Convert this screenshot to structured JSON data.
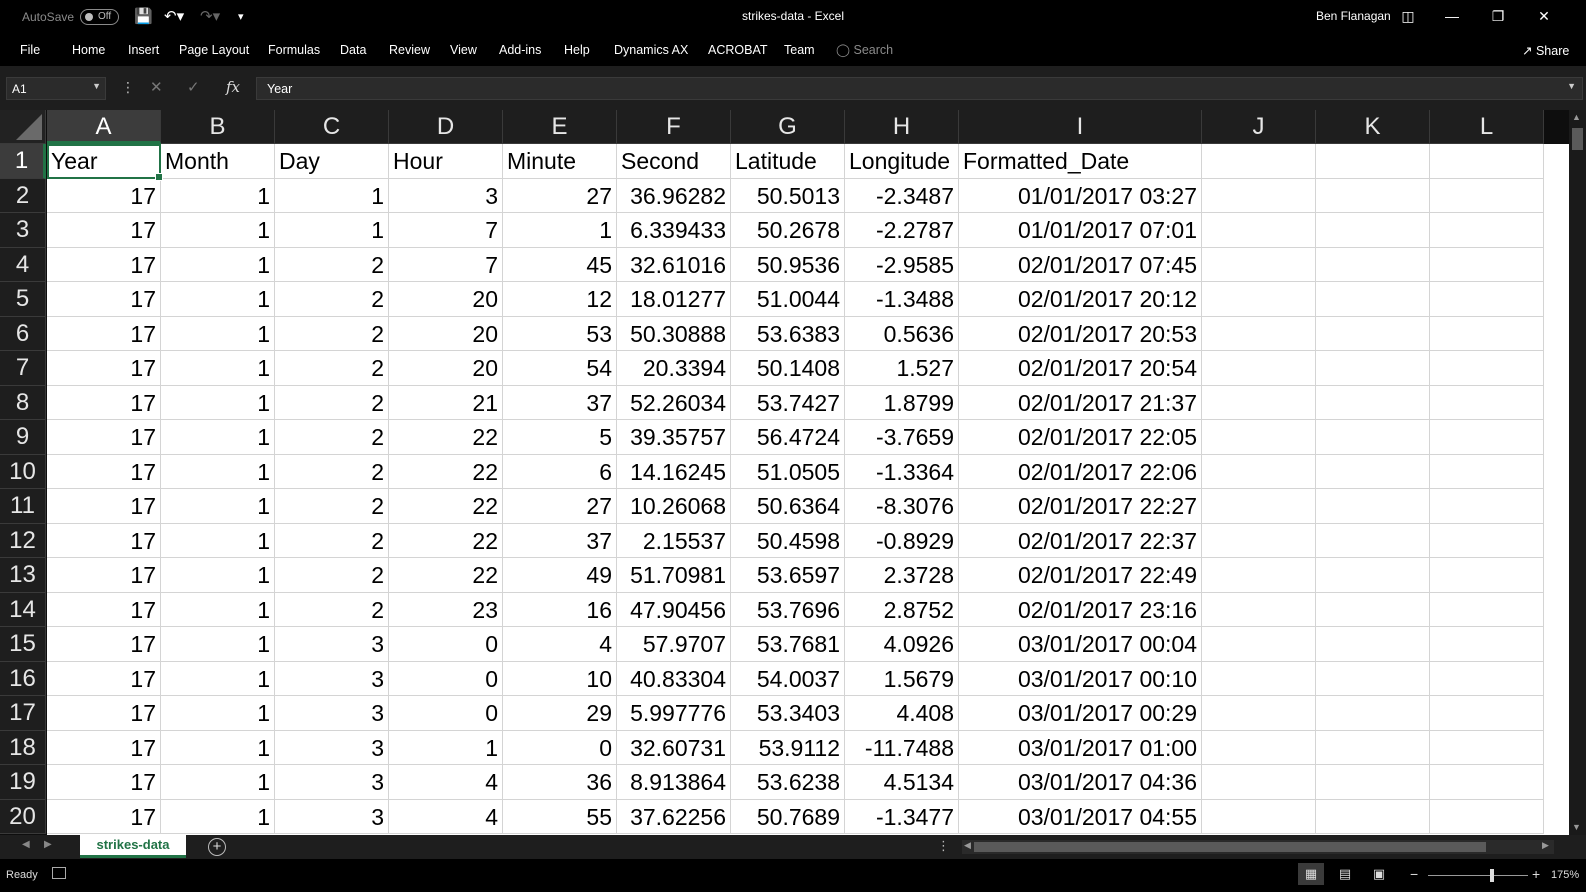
{
  "titlebar": {
    "autosave_label": "AutoSave",
    "autosave_state": "Off",
    "doc_title": "strikes-data  -  Excel",
    "user_name": "Ben Flanagan"
  },
  "ribbon": {
    "tabs": [
      "File",
      "Home",
      "Insert",
      "Page Layout",
      "Formulas",
      "Data",
      "Review",
      "View",
      "Add-ins",
      "Help",
      "Dynamics AX",
      "ACROBAT",
      "Team"
    ],
    "search_placeholder": "Search",
    "share_label": "Share"
  },
  "formula_bar": {
    "name_box": "A1",
    "fx_label": "fx",
    "formula": "Year"
  },
  "sheet": {
    "columns": [
      "A",
      "B",
      "C",
      "D",
      "E",
      "F",
      "G",
      "H",
      "I",
      "J",
      "K",
      "L"
    ],
    "header_row": [
      "Year",
      "Month",
      "Day",
      "Hour",
      "Minute",
      "Second",
      "Latitude",
      "Longitude",
      "Formatted_Date"
    ],
    "rows": [
      [
        "17",
        "1",
        "1",
        "3",
        "27",
        "36.96282",
        "50.5013",
        "-2.3487",
        "01/01/2017 03:27"
      ],
      [
        "17",
        "1",
        "1",
        "7",
        "1",
        "6.339433",
        "50.2678",
        "-2.2787",
        "01/01/2017 07:01"
      ],
      [
        "17",
        "1",
        "2",
        "7",
        "45",
        "32.61016",
        "50.9536",
        "-2.9585",
        "02/01/2017 07:45"
      ],
      [
        "17",
        "1",
        "2",
        "20",
        "12",
        "18.01277",
        "51.0044",
        "-1.3488",
        "02/01/2017 20:12"
      ],
      [
        "17",
        "1",
        "2",
        "20",
        "53",
        "50.30888",
        "53.6383",
        "0.5636",
        "02/01/2017 20:53"
      ],
      [
        "17",
        "1",
        "2",
        "20",
        "54",
        "20.3394",
        "50.1408",
        "1.527",
        "02/01/2017 20:54"
      ],
      [
        "17",
        "1",
        "2",
        "21",
        "37",
        "52.26034",
        "53.7427",
        "1.8799",
        "02/01/2017 21:37"
      ],
      [
        "17",
        "1",
        "2",
        "22",
        "5",
        "39.35757",
        "56.4724",
        "-3.7659",
        "02/01/2017 22:05"
      ],
      [
        "17",
        "1",
        "2",
        "22",
        "6",
        "14.16245",
        "51.0505",
        "-1.3364",
        "02/01/2017 22:06"
      ],
      [
        "17",
        "1",
        "2",
        "22",
        "27",
        "10.26068",
        "50.6364",
        "-8.3076",
        "02/01/2017 22:27"
      ],
      [
        "17",
        "1",
        "2",
        "22",
        "37",
        "2.15537",
        "50.4598",
        "-0.8929",
        "02/01/2017 22:37"
      ],
      [
        "17",
        "1",
        "2",
        "22",
        "49",
        "51.70981",
        "53.6597",
        "2.3728",
        "02/01/2017 22:49"
      ],
      [
        "17",
        "1",
        "2",
        "23",
        "16",
        "47.90456",
        "53.7696",
        "2.8752",
        "02/01/2017 23:16"
      ],
      [
        "17",
        "1",
        "3",
        "0",
        "4",
        "57.9707",
        "53.7681",
        "4.0926",
        "03/01/2017 00:04"
      ],
      [
        "17",
        "1",
        "3",
        "0",
        "10",
        "40.83304",
        "54.0037",
        "1.5679",
        "03/01/2017 00:10"
      ],
      [
        "17",
        "1",
        "3",
        "0",
        "29",
        "5.997776",
        "53.3403",
        "4.408",
        "03/01/2017 00:29"
      ],
      [
        "17",
        "1",
        "3",
        "1",
        "0",
        "32.60731",
        "53.9112",
        "-11.7488",
        "03/01/2017 01:00"
      ],
      [
        "17",
        "1",
        "3",
        "4",
        "36",
        "8.913864",
        "53.6238",
        "4.5134",
        "03/01/2017 04:36"
      ],
      [
        "17",
        "1",
        "3",
        "4",
        "55",
        "37.62256",
        "50.7689",
        "-1.3477",
        "03/01/2017 04:55"
      ]
    ],
    "active_cell": "A1"
  },
  "sheet_tabs": {
    "active": "strikes-data"
  },
  "statusbar": {
    "ready": "Ready",
    "zoom": "175%"
  },
  "colors": {
    "accent": "#217346",
    "chrome": "#000000",
    "header_bg": "#1e1e1e"
  }
}
